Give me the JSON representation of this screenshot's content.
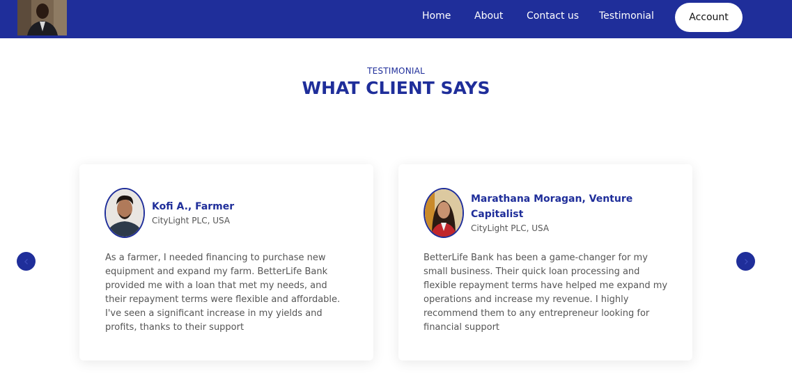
{
  "nav": {
    "links": [
      "Home",
      "About",
      "Contact us",
      "Testimonial"
    ],
    "account_label": "Account"
  },
  "section": {
    "eyebrow": "TESTIMONIAL",
    "title": "WHAT CLIENT SAYS"
  },
  "testimonials": [
    {
      "name": "Kofi A., Farmer",
      "company": "CityLight PLC, USA",
      "quote": "As a farmer, I needed financing to purchase new equipment and expand my farm. BetterLife Bank provided me with a loan that met my needs, and their repayment terms were flexible and affordable. I've seen a significant increase in my yields and profits, thanks to their support"
    },
    {
      "name": "Marathana Moragan, Venture Capitalist",
      "company": "CityLight PLC, USA",
      "quote": "BetterLife Bank has been a game-changer for my small business. Their quick loan processing and flexible repayment terms have helped me expand my operations and increase my revenue. I highly recommend them to any entrepreneur looking for financial support"
    }
  ],
  "colors": {
    "brand": "#1f2e9a",
    "card_bg": "#ffffff",
    "body_text": "#555555"
  },
  "icons": {
    "prev": "chevron-left-icon",
    "next": "chevron-right-icon"
  }
}
